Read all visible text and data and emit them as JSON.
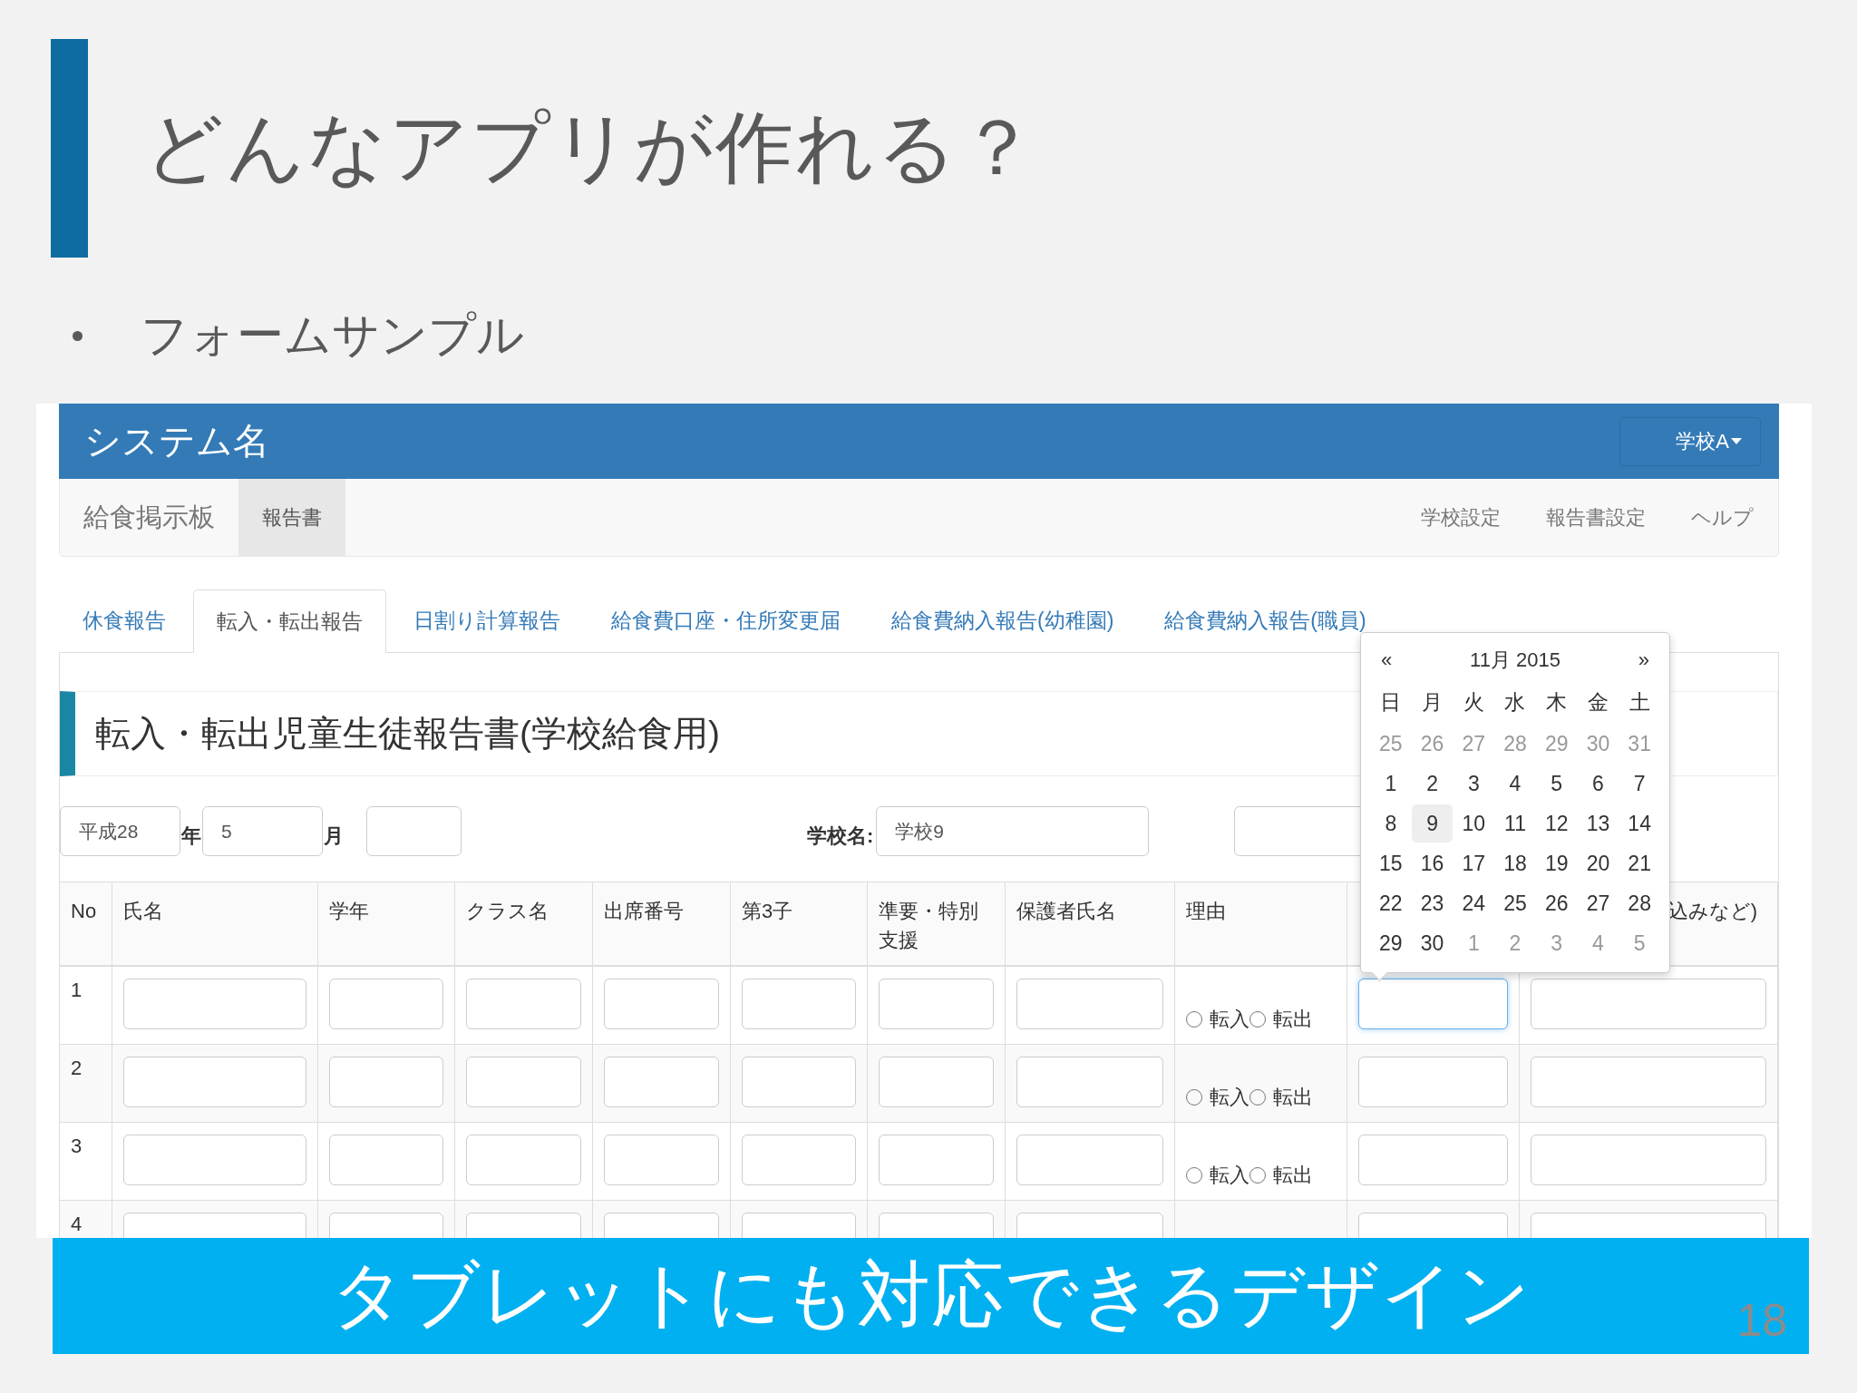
{
  "slide": {
    "title": "どんなアプリが作れる？",
    "bullets": [
      "フォームサンプル"
    ],
    "banner": "タブレットにも対応できるデザイン",
    "page_number": "18"
  },
  "app": {
    "brand": "システム名",
    "school_menu": "学校A",
    "nav_left": [
      {
        "label": "給食掲示板",
        "selected": false
      },
      {
        "label": "報告書",
        "selected": true
      }
    ],
    "nav_right": [
      "学校設定",
      "報告書設定",
      "ヘルプ"
    ],
    "tabs": [
      {
        "label": "休食報告",
        "selected": false
      },
      {
        "label": "転入・転出報告",
        "selected": true
      },
      {
        "label": "日割り計算報告",
        "selected": false
      },
      {
        "label": "給食費口座・住所変更届",
        "selected": false
      },
      {
        "label": "給食費納入報告(幼稚園)",
        "selected": false
      },
      {
        "label": "給食費納入報告(職員)",
        "selected": false
      }
    ],
    "form_title": "転入・転出児童生徒報告書(学校給食用)",
    "filter": {
      "era": "平成28",
      "era_unit": "年",
      "month": "5",
      "month_unit": "月",
      "school_label": "学校名:",
      "school": "学校9"
    },
    "table": {
      "columns": [
        {
          "label": "No",
          "kind": "number"
        },
        {
          "label": "氏名",
          "kind": "input"
        },
        {
          "label": "学年",
          "kind": "input"
        },
        {
          "label": "クラス名",
          "kind": "input"
        },
        {
          "label": "出席番号",
          "kind": "input"
        },
        {
          "label": "第3子",
          "kind": "input"
        },
        {
          "label": "準要・特別支援",
          "kind": "input"
        },
        {
          "label": "保護者氏名",
          "kind": "input"
        },
        {
          "label": "理由",
          "kind": "radio"
        },
        {
          "kind": "date"
        },
        {
          "label": "込みなど)",
          "kind": "input"
        }
      ],
      "rows": [
        {
          "no": "1",
          "date_focused": true,
          "reason": [
            {
              "label": "転入",
              "selected": false
            },
            {
              "label": "転出",
              "selected": false
            }
          ]
        },
        {
          "no": "2",
          "date_focused": false,
          "reason": [
            {
              "label": "転入",
              "selected": false
            },
            {
              "label": "転出",
              "selected": false
            }
          ]
        },
        {
          "no": "3",
          "date_focused": false,
          "reason": [
            {
              "label": "転入",
              "selected": false
            },
            {
              "label": "転出",
              "selected": false
            }
          ]
        },
        {
          "no": "4",
          "date_focused": false
        }
      ]
    },
    "calendar": {
      "prev": "«",
      "title": "11月 2015",
      "next": "»",
      "weekdays": [
        "日",
        "月",
        "火",
        "水",
        "木",
        "金",
        "土"
      ],
      "weeks": [
        [
          {
            "day": "25",
            "muted": true,
            "selected": false
          },
          {
            "day": "26",
            "muted": true,
            "selected": false
          },
          {
            "day": "27",
            "muted": true,
            "selected": false
          },
          {
            "day": "28",
            "muted": true,
            "selected": false
          },
          {
            "day": "29",
            "muted": true,
            "selected": false
          },
          {
            "day": "30",
            "muted": true,
            "selected": false
          },
          {
            "day": "31",
            "muted": true,
            "selected": false
          }
        ],
        [
          {
            "day": "1",
            "muted": false,
            "selected": false
          },
          {
            "day": "2",
            "muted": false,
            "selected": false
          },
          {
            "day": "3",
            "muted": false,
            "selected": false
          },
          {
            "day": "4",
            "muted": false,
            "selected": false
          },
          {
            "day": "5",
            "muted": false,
            "selected": false
          },
          {
            "day": "6",
            "muted": false,
            "selected": false
          },
          {
            "day": "7",
            "muted": false,
            "selected": false
          }
        ],
        [
          {
            "day": "8",
            "muted": false,
            "selected": false
          },
          {
            "day": "9",
            "muted": false,
            "selected": true
          },
          {
            "day": "10",
            "muted": false,
            "selected": false
          },
          {
            "day": "11",
            "muted": false,
            "selected": false
          },
          {
            "day": "12",
            "muted": false,
            "selected": false
          },
          {
            "day": "13",
            "muted": false,
            "selected": false
          },
          {
            "day": "14",
            "muted": false,
            "selected": false
          }
        ],
        [
          {
            "day": "15",
            "muted": false,
            "selected": false
          },
          {
            "day": "16",
            "muted": false,
            "selected": false
          },
          {
            "day": "17",
            "muted": false,
            "selected": false
          },
          {
            "day": "18",
            "muted": false,
            "selected": false
          },
          {
            "day": "19",
            "muted": false,
            "selected": false
          },
          {
            "day": "20",
            "muted": false,
            "selected": false
          },
          {
            "day": "21",
            "muted": false,
            "selected": false
          }
        ],
        [
          {
            "day": "22",
            "muted": false,
            "selected": false
          },
          {
            "day": "23",
            "muted": false,
            "selected": false
          },
          {
            "day": "24",
            "muted": false,
            "selected": false
          },
          {
            "day": "25",
            "muted": false,
            "selected": false
          },
          {
            "day": "26",
            "muted": false,
            "selected": false
          },
          {
            "day": "27",
            "muted": false,
            "selected": false
          },
          {
            "day": "28",
            "muted": false,
            "selected": false
          }
        ],
        [
          {
            "day": "29",
            "muted": false,
            "selected": false
          },
          {
            "day": "30",
            "muted": false,
            "selected": false
          },
          {
            "day": "1",
            "muted": true,
            "selected": false
          },
          {
            "day": "2",
            "muted": true,
            "selected": false
          },
          {
            "day": "3",
            "muted": true,
            "selected": false
          },
          {
            "day": "4",
            "muted": true,
            "selected": false
          },
          {
            "day": "5",
            "muted": true,
            "selected": false
          }
        ]
      ]
    }
  }
}
